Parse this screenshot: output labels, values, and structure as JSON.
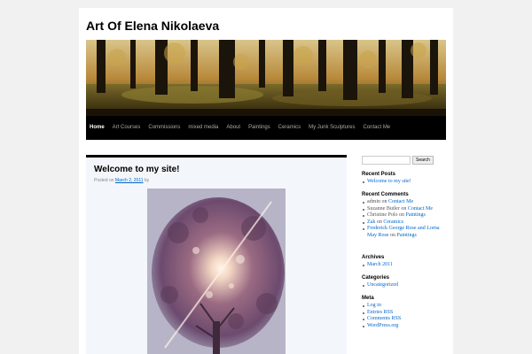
{
  "site": {
    "title": "Art Of Elena Nikolaeva"
  },
  "nav": {
    "items": [
      {
        "label": "Home"
      },
      {
        "label": "Art Courses"
      },
      {
        "label": "Commissions"
      },
      {
        "label": "mixed media"
      },
      {
        "label": "About"
      },
      {
        "label": "Paintings"
      },
      {
        "label": "Ceramics"
      },
      {
        "label": "My Junk Sculptures"
      },
      {
        "label": "Contact Me"
      }
    ]
  },
  "post": {
    "title": "Welcome to my site!",
    "posted_on": "Posted on",
    "date": "March 2, 2011",
    "by": "by"
  },
  "sidebar": {
    "search": {
      "button": "Search",
      "placeholder": ""
    },
    "recent_posts": {
      "title": "Recent Posts",
      "items": [
        "Welcome to my site!"
      ]
    },
    "recent_comments": {
      "title": "Recent Comments",
      "items": [
        {
          "author": "admin",
          "on": "on",
          "post": "Contact Me"
        },
        {
          "author": "Suzanne Butler",
          "on": "on",
          "post": "Contact Me"
        },
        {
          "author": "Christine Polo",
          "on": "on",
          "post": "Paintings"
        },
        {
          "author": "Zak",
          "on": "on",
          "post": "Ceramics"
        },
        {
          "author": "Frederick George Rose and Lorna May Rose",
          "on": "on",
          "post": "Paintings"
        }
      ]
    },
    "archives": {
      "title": "Archives",
      "items": [
        "March 2011"
      ]
    },
    "categories": {
      "title": "Categories",
      "items": [
        "Uncategorized"
      ]
    },
    "meta": {
      "title": "Meta",
      "items": [
        "Log in",
        "Entries RSS",
        "Comments RSS",
        "WordPress.org"
      ]
    }
  },
  "colors": {
    "link": "#0066cc",
    "nav_bg": "#000000",
    "page_bg": "#f1f1f1"
  }
}
